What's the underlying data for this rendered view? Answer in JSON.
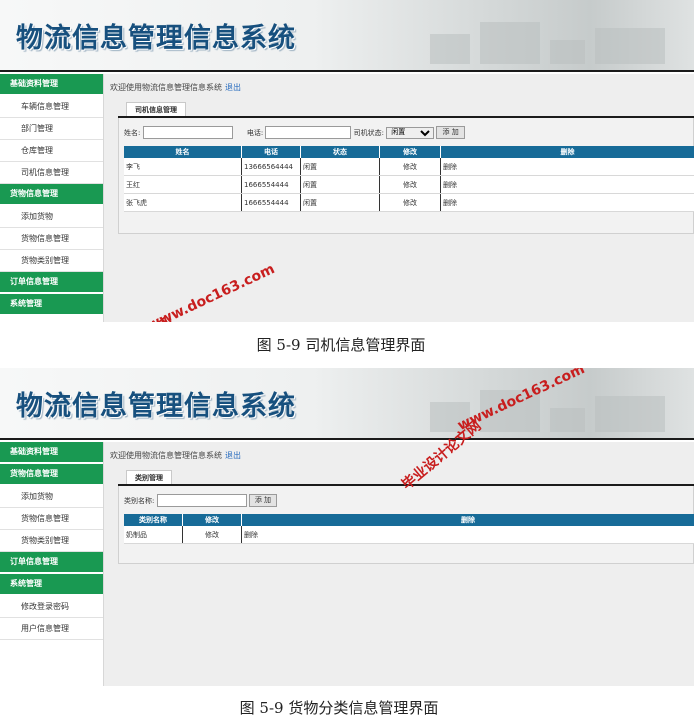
{
  "system_title": "物流信息管理信息系统",
  "welcome_text": "欢迎使用物流信息管理信息系统",
  "logout_label": "退出",
  "screen1": {
    "sidebar": [
      {
        "type": "head",
        "label": "基础资料管理"
      },
      {
        "type": "item",
        "label": "车辆信息管理"
      },
      {
        "type": "item",
        "label": "部门管理"
      },
      {
        "type": "item",
        "label": "仓库管理"
      },
      {
        "type": "item",
        "label": "司机信息管理"
      },
      {
        "type": "head",
        "label": "货物信息管理"
      },
      {
        "type": "item",
        "label": "添加货物"
      },
      {
        "type": "item",
        "label": "货物信息管理"
      },
      {
        "type": "item",
        "label": "货物类别管理"
      },
      {
        "type": "head",
        "label": "订单信息管理"
      },
      {
        "type": "head",
        "label": "系统管理"
      }
    ],
    "tab": "司机信息管理",
    "search": {
      "name_label": "姓名:",
      "phone_label": "电话:",
      "status_label": "司机状态:",
      "status_selected": "闲置",
      "add_button": "添 加"
    },
    "columns": [
      "姓名",
      "电话",
      "状态",
      "修改",
      "删除"
    ],
    "rows": [
      {
        "name": "李飞",
        "phone": "13666564444",
        "status": "闲置",
        "edit": "修改",
        "delete": "删除"
      },
      {
        "name": "王红",
        "phone": "1666554444",
        "status": "闲置",
        "edit": "修改",
        "delete": "删除"
      },
      {
        "name": "张飞虎",
        "phone": "1666554444",
        "status": "闲置",
        "edit": "修改",
        "delete": "删除"
      }
    ]
  },
  "caption1": "图 5-9 司机信息管理界面",
  "screen2": {
    "sidebar": [
      {
        "type": "head",
        "label": "基础资料管理"
      },
      {
        "type": "head",
        "label": "货物信息管理"
      },
      {
        "type": "item",
        "label": "添加货物"
      },
      {
        "type": "item",
        "label": "货物信息管理"
      },
      {
        "type": "item",
        "label": "货物类别管理"
      },
      {
        "type": "head",
        "label": "订单信息管理"
      },
      {
        "type": "head",
        "label": "系统管理"
      },
      {
        "type": "item",
        "label": "修改登录密码"
      },
      {
        "type": "item",
        "label": "用户信息管理"
      }
    ],
    "tab": "类别管理",
    "search": {
      "category_label": "类别名称:",
      "add_button": "添 加"
    },
    "columns": [
      "类别名称",
      "修改",
      "删除"
    ],
    "rows": [
      {
        "category": "奶制品",
        "edit": "修改",
        "delete": "删除"
      }
    ]
  },
  "caption2": "图 5-9 货物分类信息管理界面",
  "watermark": {
    "site": "www.doc163.com",
    "name": "毕业设计论文网",
    "color": "#c81e1e"
  }
}
